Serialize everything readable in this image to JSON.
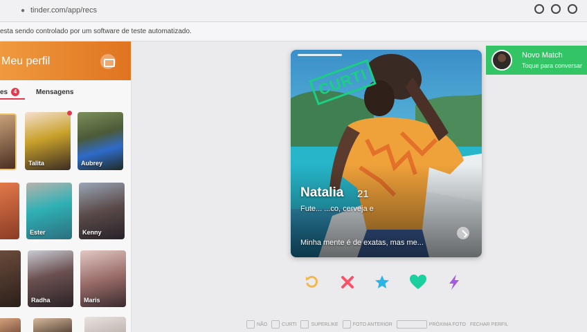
{
  "browser": {
    "url": "tinder.com/app/recs",
    "info_bar": "esta sendo controlado por um software de teste automatizado."
  },
  "sidebar": {
    "profile_title": "Meu perfil",
    "tabs": {
      "matches_label": "es",
      "matches_badge": "4",
      "messages_label": "Mensagens"
    },
    "matches": [
      {
        "name": "",
        "new": false
      },
      {
        "name": "Talita",
        "new": true
      },
      {
        "name": "Aubrey",
        "new": false
      },
      {
        "name": "",
        "new": false
      },
      {
        "name": "Ester",
        "new": false
      },
      {
        "name": "Kenny",
        "new": false
      },
      {
        "name": "",
        "new": false
      },
      {
        "name": "Radha",
        "new": false
      },
      {
        "name": "Maris",
        "new": false
      }
    ]
  },
  "card": {
    "stamp": "CURTI",
    "name": "Natalia",
    "age": "21",
    "interests": "Fute...     ...co, cerveja e",
    "bio": "Minha mente é de exatas, mas me..."
  },
  "actions": [
    {
      "icon": "rewind-icon",
      "color": "#f5b748"
    },
    {
      "icon": "nope-icon",
      "color": "#fd5068"
    },
    {
      "icon": "super-like-icon",
      "color": "#2db4e6"
    },
    {
      "icon": "like-icon",
      "color": "#1bcf9f"
    },
    {
      "icon": "boost-icon",
      "color": "#a35be0"
    }
  ],
  "toast": {
    "title": "Novo Match",
    "subtitle": "Toque para conversar"
  },
  "shortcuts": [
    {
      "label": "NÃO"
    },
    {
      "label": "CURTI"
    },
    {
      "label": "SUPERLIKE"
    },
    {
      "label": "FOTO ANTERIOR"
    },
    {
      "label": "PRÓXIMA FOTO"
    },
    {
      "label": "FECHAR PERFIL"
    }
  ],
  "colors": {
    "brand_gradient_start": "#ef9a3f",
    "brand_gradient_end": "#e0731f",
    "like_green": "#1bcf82",
    "match_toast_green": "#33c466",
    "badge_red": "#e23a4c"
  }
}
